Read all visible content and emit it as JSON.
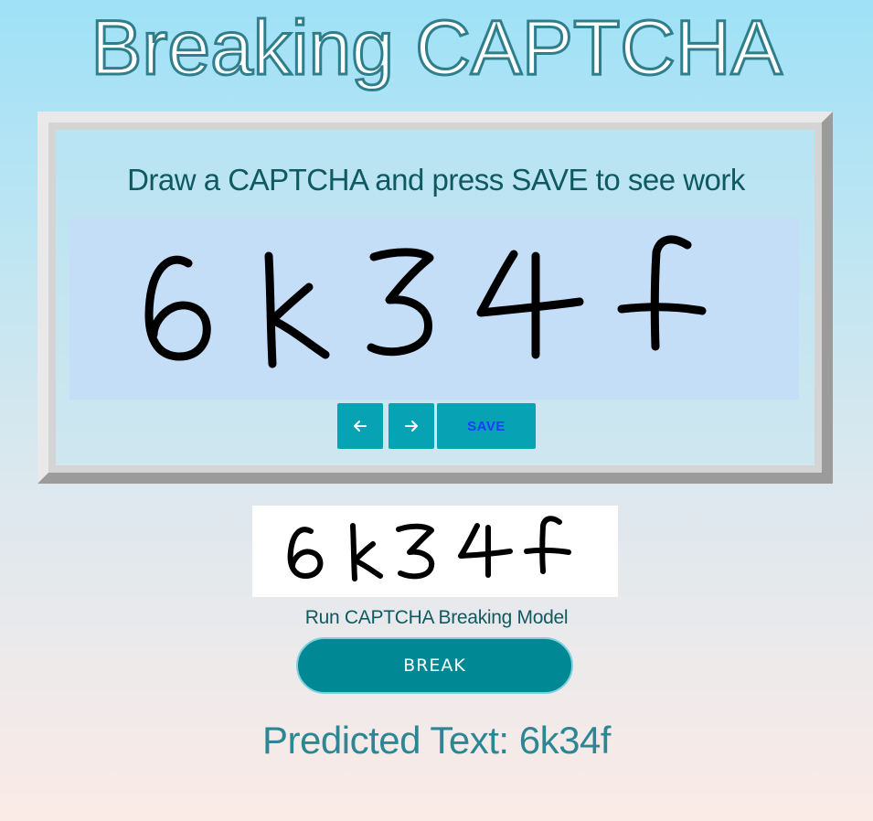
{
  "app": {
    "title": "Breaking CAPTCHA"
  },
  "drawing_panel": {
    "instruction": "Draw a CAPTCHA and press SAVE to see work",
    "canvas_text": "6k34f",
    "undo_icon": "arrow-left-icon",
    "redo_icon": "arrow-right-icon",
    "save_label": "SAVE"
  },
  "preview": {
    "image_text": "6k34f"
  },
  "model": {
    "caption": "Run CAPTCHA Breaking Model",
    "break_label": "BREAK"
  },
  "result": {
    "prediction": "Predicted Text: 6k34f"
  },
  "colors": {
    "accent_teal": "#018895",
    "tool_button": "#07a3b4",
    "save_text": "#1a3dff",
    "canvas_bg": "#c4def8",
    "title_stroke": "#2e7f8b"
  }
}
